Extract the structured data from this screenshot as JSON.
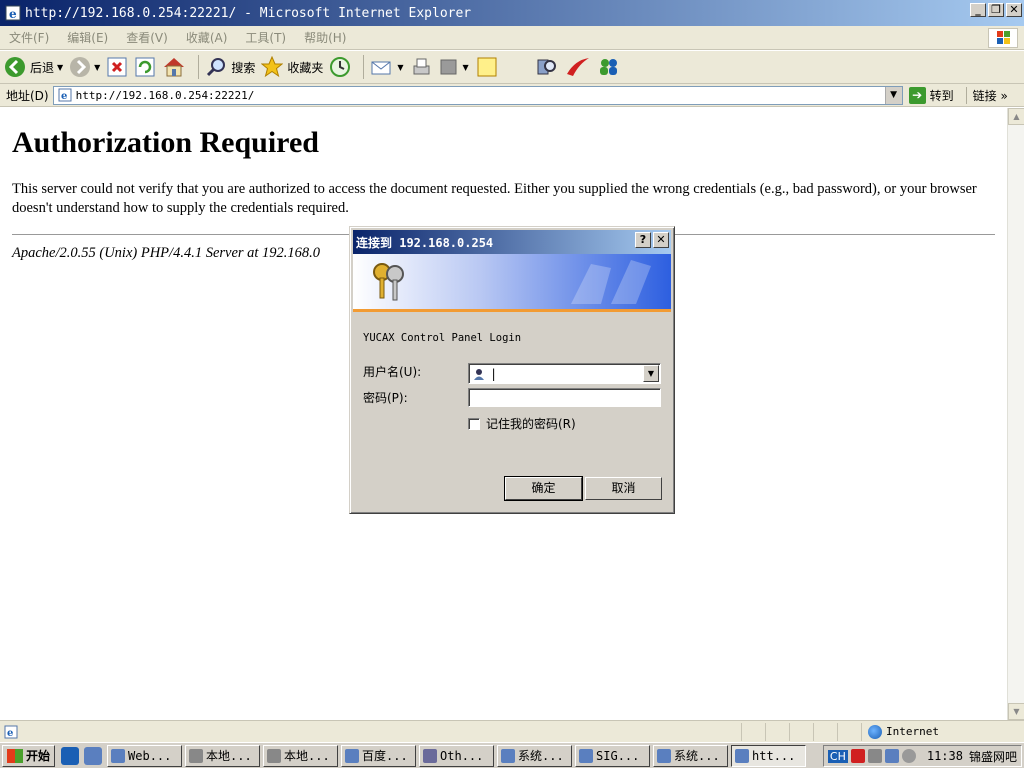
{
  "window": {
    "title": "http://192.168.0.254:22221/ - Microsoft Internet Explorer",
    "minimize": "_",
    "restore": "❐",
    "close": "✕"
  },
  "menu": {
    "items": [
      "文件(F)",
      "编辑(E)",
      "查看(V)",
      "收藏(A)",
      "工具(T)",
      "帮助(H)"
    ]
  },
  "toolbar": {
    "back_label": "后退",
    "search_label": "搜索",
    "favorites_label": "收藏夹"
  },
  "address": {
    "label": "地址(D)",
    "url": "http://192.168.0.254:22221/",
    "go_label": "转到",
    "links_label": "链接",
    "links_chevron": "»"
  },
  "page": {
    "heading": "Authorization Required",
    "body": "This server could not verify that you are authorized to access the document requested. Either you supplied the wrong credentials (e.g., bad password), or your browser doesn't understand how to supply the credentials required.",
    "footer": "Apache/2.0.55 (Unix) PHP/4.4.1 Server at 192.168.0"
  },
  "statusbar": {
    "zone": "Internet"
  },
  "taskbar": {
    "start_label": "开始",
    "tasks": [
      "Web...",
      "本地...",
      "本地...",
      "百度...",
      "Oth...",
      "系统...",
      "SIG...",
      "系统...",
      "htt..."
    ],
    "ime": "CH",
    "time": "11:38",
    "tray_text": "锦盛网吧"
  },
  "dialog": {
    "title": "连接到 192.168.0.254",
    "help": "?",
    "close": "✕",
    "realm": "YUCAX Control Panel Login",
    "username_label": "用户名(U):",
    "username_value": "|",
    "password_label": "密码(P):",
    "remember_label": "记住我的密码(R)",
    "ok_label": "确定",
    "cancel_label": "取消"
  },
  "colors": {
    "titlebar": "#0a246a",
    "chrome": "#ece9d8",
    "dialog_face": "#d4d0c8",
    "banner_stripe": "#f29b33"
  }
}
